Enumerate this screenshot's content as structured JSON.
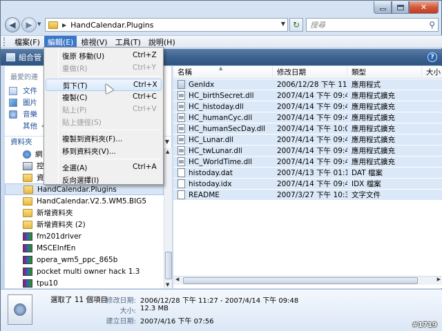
{
  "address": {
    "path": "HandCalendar.Plugins"
  },
  "search": {
    "placeholder": "搜尋"
  },
  "menubar": [
    "檔案(F)",
    "編輯(E)",
    "檢視(V)",
    "工具(T)",
    "說明(H)"
  ],
  "toolbar": {
    "organize_label": "組合管"
  },
  "favorites": {
    "title": "最愛的連",
    "items": [
      "文件",
      "圖片",
      "音樂"
    ],
    "more_label": "其他"
  },
  "folders": {
    "header": "資料夾",
    "items": [
      {
        "label": "網",
        "icon": "network-icon"
      },
      {
        "label": "控",
        "icon": "control-panel-icon"
      },
      {
        "label": "資",
        "icon": "folder-icon"
      },
      {
        "label": "HandCalendar.Plugins",
        "icon": "folder-icon"
      },
      {
        "label": "HandCalendar.V2.5.WM5.BIG5",
        "icon": "folder-icon"
      },
      {
        "label": "新增資料夾",
        "icon": "folder-icon"
      },
      {
        "label": "新增資料夾 (2)",
        "icon": "folder-icon"
      },
      {
        "label": "fm201driver",
        "icon": "rar-icon"
      },
      {
        "label": "MSCEInfEn",
        "icon": "rar-icon"
      },
      {
        "label": "opera_wm5_ppc_865b",
        "icon": "rar-icon"
      },
      {
        "label": "pocket multi owner hack 1.3",
        "icon": "rar-icon"
      },
      {
        "label": "tpu10",
        "icon": "rar-icon"
      }
    ]
  },
  "columns": [
    "名稱",
    "修改日期",
    "類型",
    "大小"
  ],
  "files": [
    {
      "name": "GenIdx",
      "date": "2006/12/28 下午 11...",
      "type": "應用程式",
      "icon": "exe"
    },
    {
      "name": "HC_birthSecret.dll",
      "date": "2007/4/14 下午 09:48",
      "type": "應用程式擴充",
      "icon": "dll"
    },
    {
      "name": "HC_histoday.dll",
      "date": "2007/4/14 下午 09:48",
      "type": "應用程式擴充",
      "icon": "dll"
    },
    {
      "name": "HC_humanCyc.dll",
      "date": "2007/4/14 下午 09:48",
      "type": "應用程式擴充",
      "icon": "dll"
    },
    {
      "name": "HC_humanSecDay.dll",
      "date": "2007/4/14 下午 10:06",
      "type": "應用程式擴充",
      "icon": "dll"
    },
    {
      "name": "HC_Lunar.dll",
      "date": "2007/4/14 下午 09:48",
      "type": "應用程式擴充",
      "icon": "dll"
    },
    {
      "name": "HC_twLunar.dll",
      "date": "2007/4/14 下午 09:49",
      "type": "應用程式擴充",
      "icon": "dll"
    },
    {
      "name": "HC_WorldTime.dll",
      "date": "2007/4/14 下午 09:48",
      "type": "應用程式擴充",
      "icon": "dll"
    },
    {
      "name": "histoday.dat",
      "date": "2007/4/13 下午 01:13",
      "type": "DAT 檔案",
      "icon": "file"
    },
    {
      "name": "histoday.idx",
      "date": "2007/4/14 下午 09:49",
      "type": "IDX 檔案",
      "icon": "file"
    },
    {
      "name": "README",
      "date": "2007/3/27 下午 10:38",
      "type": "文字文件",
      "icon": "file"
    }
  ],
  "edit_menu": [
    {
      "label": "復原 移動(U)",
      "shortcut": "Ctrl+Z",
      "disabled": false
    },
    {
      "label": "重做(R)",
      "shortcut": "Ctrl+Y",
      "disabled": true
    },
    {
      "sep": true
    },
    {
      "label": "剪下(T)",
      "shortcut": "Ctrl+X",
      "disabled": false,
      "highlight": true
    },
    {
      "label": "複製(C)",
      "shortcut": "Ctrl+C",
      "disabled": false
    },
    {
      "label": "貼上(P)",
      "shortcut": "Ctrl+V",
      "disabled": true
    },
    {
      "label": "貼上捷徑(S)",
      "shortcut": "",
      "disabled": true
    },
    {
      "sep": true
    },
    {
      "label": "複製到資料夾(F)...",
      "shortcut": "",
      "disabled": false
    },
    {
      "label": "移到資料夾(V)...",
      "shortcut": "",
      "disabled": false
    },
    {
      "sep": true
    },
    {
      "label": "全選(A)",
      "shortcut": "Ctrl+A",
      "disabled": false
    },
    {
      "label": "反向選擇(I)",
      "shortcut": "",
      "disabled": false
    }
  ],
  "details": {
    "title": "選取了 11 個項目",
    "rows": [
      {
        "label": "修改日期:",
        "value": "2006/12/28 下午 11:27 - 2007/4/14 下午 09:48"
      },
      {
        "label": "大小:",
        "value": "12.3 MB"
      },
      {
        "label": "建立日期:",
        "value": "2007/4/16 下午 07:56"
      }
    ]
  },
  "watermark": "#1719"
}
